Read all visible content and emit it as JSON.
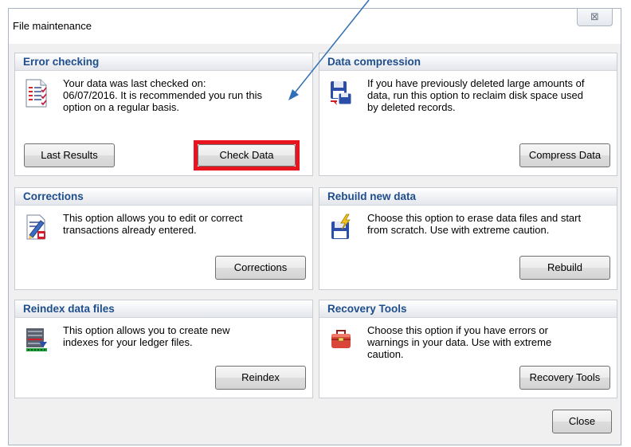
{
  "window": {
    "title": "File maintenance",
    "close_glyph": "⊠"
  },
  "panels": {
    "error_checking": {
      "title": "Error checking",
      "icon": "checklist-icon",
      "desc": [
        "Your data was last checked on:",
        "06/07/2016.  It is recommended you run this",
        "option on a regular basis."
      ],
      "buttons": {
        "last_results": "Last Results",
        "check_data": "Check Data"
      }
    },
    "data_compression": {
      "title": "Data compression",
      "icon": "floppy-compress-icon",
      "desc": [
        "If you have previously deleted large amounts of",
        "data, run this option to reclaim disk space used",
        "by deleted records."
      ],
      "buttons": {
        "compress_data": "Compress Data"
      }
    },
    "corrections": {
      "title": "Corrections",
      "icon": "edit-document-icon",
      "desc": [
        "This option allows you to edit or correct",
        "transactions already entered."
      ],
      "buttons": {
        "corrections": "Corrections"
      }
    },
    "rebuild": {
      "title": "Rebuild new data",
      "icon": "floppy-lightning-icon",
      "desc": [
        "Choose this option to erase data files and start",
        "from scratch. Use with extreme caution."
      ],
      "buttons": {
        "rebuild": "Rebuild"
      }
    },
    "reindex": {
      "title": "Reindex data files",
      "icon": "database-index-icon",
      "desc": [
        "This option allows you to create new",
        "indexes for your ledger files."
      ],
      "buttons": {
        "reindex": "Reindex"
      }
    },
    "recovery": {
      "title": "Recovery Tools",
      "icon": "toolbox-icon",
      "desc": [
        "Choose this option if you have errors or",
        "warnings in your data. Use with extreme",
        "caution."
      ],
      "buttons": {
        "recovery_tools": "Recovery Tools"
      }
    }
  },
  "footer": {
    "close": "Close"
  },
  "colors": {
    "panel_title": "#1f4e8c",
    "highlight": "#e8141e",
    "arrow": "#2f6fb5"
  }
}
